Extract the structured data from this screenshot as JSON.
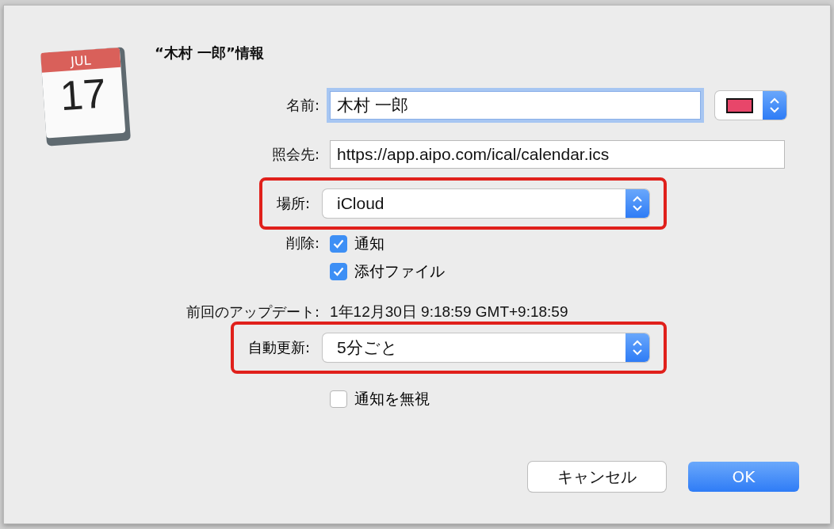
{
  "icon": {
    "month": "JUL",
    "day": "17"
  },
  "title": "“木村 一郎”情報",
  "name_row": {
    "label": "名前:",
    "value": "木村 一郎",
    "focused": true,
    "color": "#e8466a"
  },
  "url_row": {
    "label": "照会先:",
    "value": "https://app.aipo.com/ical/calendar.ics"
  },
  "location_row": {
    "label": "場所:",
    "value": "iCloud",
    "highlighted": true
  },
  "delete_row": {
    "label": "削除:",
    "options": [
      {
        "label": "通知",
        "checked": true
      },
      {
        "label": "添付ファイル",
        "checked": true
      }
    ]
  },
  "last_update": {
    "label": "前回のアップデート:",
    "value": "1年12月30日 9:18:59 GMT+9:18:59"
  },
  "auto_update_row": {
    "label": "自動更新:",
    "value": "5分ごと",
    "highlighted": true
  },
  "ignore_alerts": {
    "label": "通知を無視",
    "checked": false
  },
  "buttons": [
    {
      "label": "キャンセル",
      "kind": "secondary"
    },
    {
      "label": "OK",
      "kind": "default"
    }
  ]
}
